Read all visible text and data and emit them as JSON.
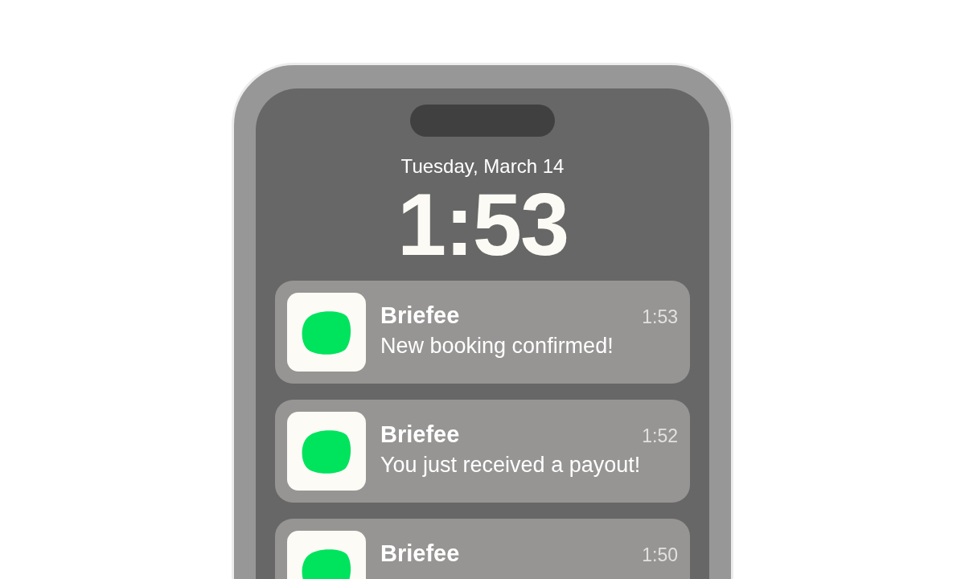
{
  "lock_screen": {
    "date": "Tuesday, March 14",
    "time": "1:53"
  },
  "notifications": [
    {
      "app": "Briefee",
      "time": "1:53",
      "message": "New booking confirmed!"
    },
    {
      "app": "Briefee",
      "time": "1:52",
      "message": "You just received a payout!"
    },
    {
      "app": "Briefee",
      "time": "1:50"
    }
  ]
}
